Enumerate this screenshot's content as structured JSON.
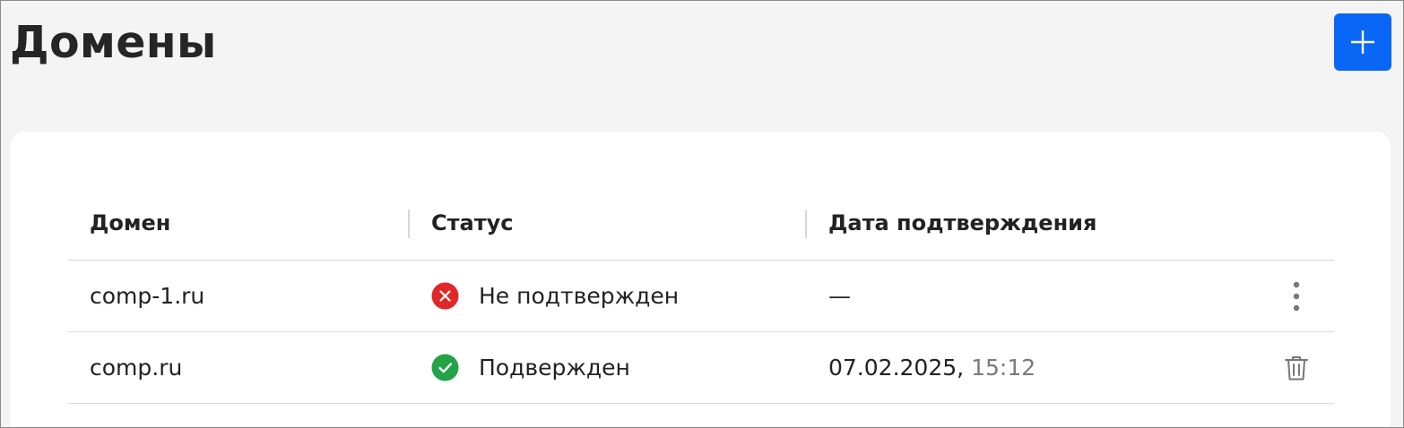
{
  "header": {
    "title": "Домены",
    "add_button_icon": "plus-icon"
  },
  "table": {
    "columns": [
      "Домен",
      "Статус",
      "Дата подтверждения"
    ],
    "rows": [
      {
        "domain": "comp-1.ru",
        "status": "Не подтвержден",
        "status_icon": "error-circle-icon",
        "status_color": "#e02828",
        "date": "—",
        "time": "",
        "action_icon": "more-vertical-icon"
      },
      {
        "domain": "comp.ru",
        "status": "Подвержден",
        "status_icon": "check-circle-icon",
        "status_color": "#22a347",
        "date": "07.02.2025,",
        "time": "15:12",
        "action_icon": "trash-icon"
      }
    ]
  },
  "colors": {
    "accent": "#0a66f5",
    "background": "#f4f4f4",
    "card": "#ffffff"
  }
}
